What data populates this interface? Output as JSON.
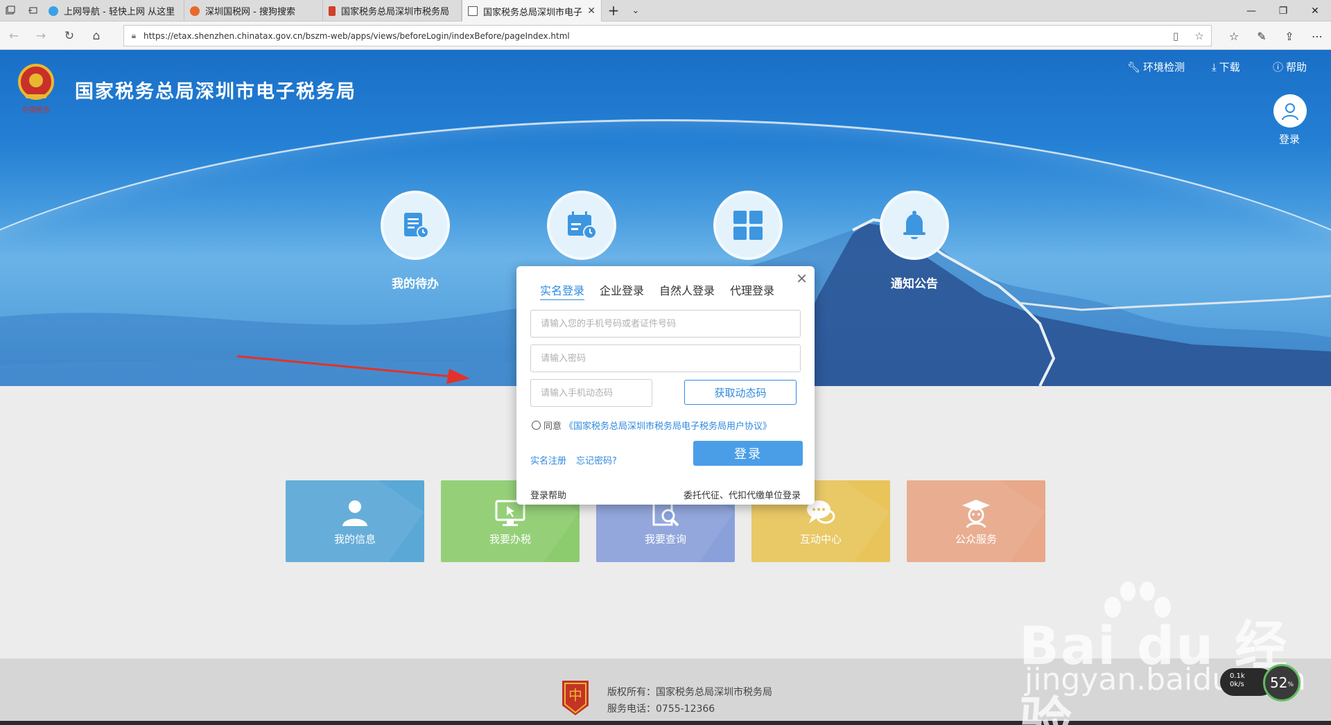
{
  "browser": {
    "tabs": [
      {
        "label": "上网导航 - 轻快上网 从这里",
        "favicon_color": "#3aa0e8"
      },
      {
        "label": "深圳国税网 - 搜狗搜索",
        "favicon_color": "#e86a2a"
      },
      {
        "label": "国家税务总局深圳市税务局",
        "favicon_color": "#d0402a"
      },
      {
        "label": "国家税务总局深圳市电子",
        "favicon_color": "#ffffff",
        "active": true
      }
    ],
    "url": "https://etax.shenzhen.chinatax.gov.cn/bszm-web/apps/views/beforeLogin/indexBefore/pageIndex.html",
    "icons": [
      "tab-list-icon",
      "back-tab-icon",
      "new-tab-icon",
      "tab-menu-icon",
      "minimize-icon",
      "restore-icon",
      "window-close-icon",
      "back-icon",
      "forward-icon",
      "refresh-icon",
      "home-icon",
      "lock-icon",
      "reading-view-icon",
      "favorite-star-icon",
      "favorites-icon",
      "pen-icon",
      "share-icon",
      "more-icon"
    ]
  },
  "header": {
    "site_title": "国家税务总局深圳市电子税务局",
    "links": {
      "env_check": "环境检测",
      "download": "下载",
      "help": "帮助"
    },
    "user_login": "登录"
  },
  "features": [
    {
      "label": "我的待办",
      "icon": "todo-list-icon"
    },
    {
      "label": "",
      "icon": "calendar-clock-icon"
    },
    {
      "label": "",
      "icon": "grid-apps-icon"
    },
    {
      "label": "通知公告",
      "icon": "bell-icon"
    }
  ],
  "tiles": [
    {
      "label": "我的信息",
      "color": "#5aa8d6",
      "icon": "person-icon"
    },
    {
      "label": "我要办税",
      "color": "#8ccc6e",
      "icon": "monitor-icon"
    },
    {
      "label": "我要查询",
      "color": "#8aa0da",
      "icon": "search-doc-icon"
    },
    {
      "label": "互动中心",
      "color": "#e8c45a",
      "icon": "chat-icon"
    },
    {
      "label": "公众服务",
      "color": "#e8a889",
      "icon": "graduate-icon"
    }
  ],
  "login_modal": {
    "tabs": [
      "实名登录",
      "企业登录",
      "自然人登录",
      "代理登录"
    ],
    "active_tab": "实名登录",
    "phone_placeholder": "请输入您的手机号码或者证件号码",
    "password_placeholder": "请输入密码",
    "sms_placeholder": "请输入手机动态码",
    "get_code_button": "获取动态码",
    "agree_prefix": "同意",
    "agreement_link": "《国家税务总局深圳市税务局电子税务局用户协议》",
    "register_link": "实名注册",
    "forgot_link": "忘记密码?",
    "login_button": "登录",
    "help_link": "登录帮助",
    "agent_link": "委托代征、代扣代缴单位登录"
  },
  "footer": {
    "copyright": "版权所有：国家税务总局深圳市税务局",
    "phone": "服务电话：0755-12366"
  },
  "watermark": {
    "brand": "Bai du 经验",
    "url": "jingyan.baidu.com"
  },
  "speed_widget": {
    "up": "0.1k",
    "down": "0k/s",
    "percent": "52",
    "unit": "%"
  },
  "colors": {
    "accent": "#2f8ae0",
    "banner": "#2480d4",
    "login_button": "#4a9ee8"
  }
}
